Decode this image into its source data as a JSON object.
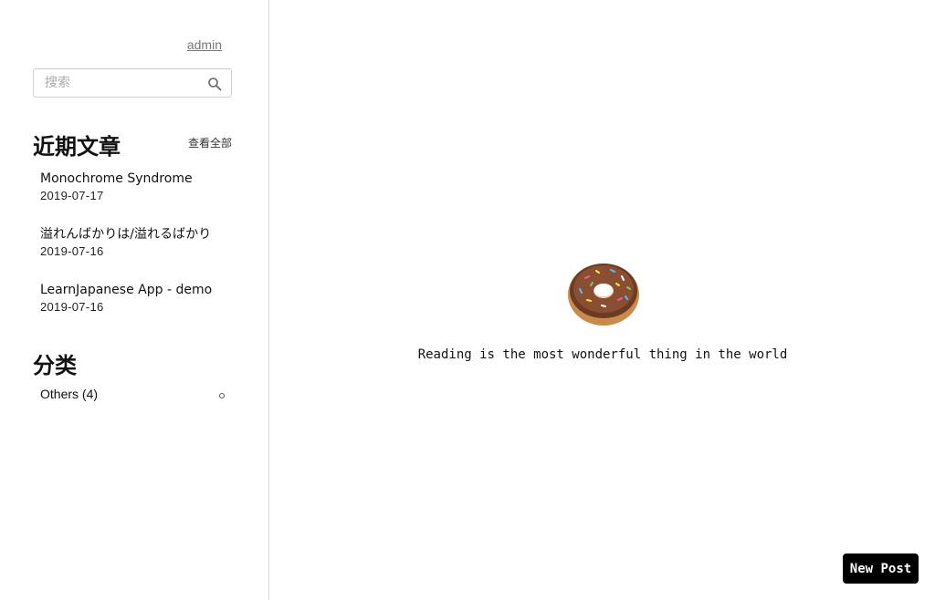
{
  "sidebar": {
    "admin_link": "admin",
    "search": {
      "placeholder": "搜索",
      "value": ""
    },
    "recent": {
      "title": "近期文章",
      "view_all": "查看全部",
      "posts": [
        {
          "title": "Monochrome Syndrome",
          "date": "2019-07-17"
        },
        {
          "title": "溢れんばかりは/溢れるばかり",
          "date": "2019-07-16"
        },
        {
          "title": "LearnJapanese App - demo",
          "date": "2019-07-16"
        }
      ]
    },
    "categories": {
      "title": "分类",
      "items": [
        {
          "label": "Others (4)"
        }
      ]
    }
  },
  "main": {
    "icon": "donut-icon",
    "quote": "Reading is the most wonderful thing in the world"
  },
  "new_post_button": "New Post"
}
